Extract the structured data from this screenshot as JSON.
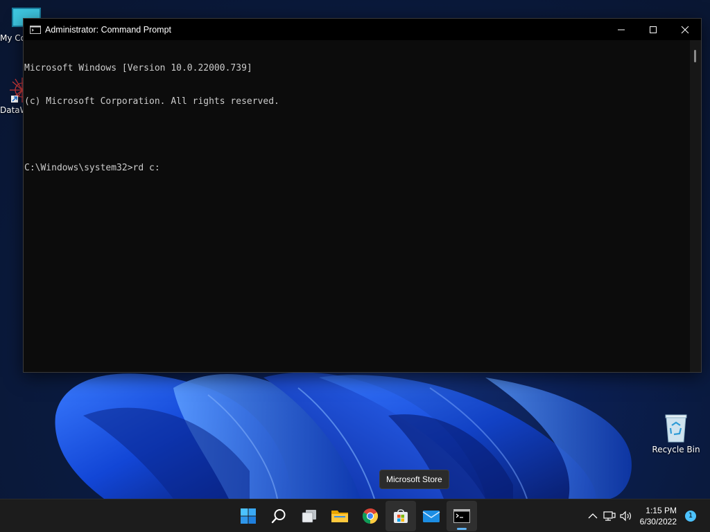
{
  "desktop": {
    "icons": [
      {
        "label": "My Computer",
        "icon": "monitor-icon"
      },
      {
        "label": "DataWarrior",
        "icon": "datawarrior-icon"
      },
      {
        "label": "Recycle Bin",
        "icon": "recycle-bin-icon"
      }
    ]
  },
  "window": {
    "title": "Administrator: Command Prompt",
    "controls": {
      "minimize": "minimize-icon",
      "maximize": "maximize-icon",
      "close": "close-icon"
    },
    "console_lines": [
      "Microsoft Windows [Version 10.0.22000.739]",
      "(c) Microsoft Corporation. All rights reserved.",
      "",
      "C:\\Windows\\system32>rd c:"
    ]
  },
  "tooltip": {
    "text": "Microsoft Store"
  },
  "taskbar": {
    "apps": [
      {
        "name": "Start",
        "icon": "windows-logo-icon"
      },
      {
        "name": "Search",
        "icon": "search-icon"
      },
      {
        "name": "Task View",
        "icon": "task-view-icon"
      },
      {
        "name": "File Explorer",
        "icon": "folder-icon"
      },
      {
        "name": "Google Chrome",
        "icon": "chrome-icon"
      },
      {
        "name": "Microsoft Store",
        "icon": "store-icon"
      },
      {
        "name": "Mail",
        "icon": "mail-icon"
      },
      {
        "name": "Command Prompt",
        "icon": "cmd-icon"
      }
    ],
    "tray": {
      "icons": [
        "chevron-up-icon",
        "network-icon",
        "volume-icon"
      ],
      "time": "1:15 PM",
      "date": "6/30/2022",
      "notification_count": "1"
    }
  },
  "colors": {
    "console_bg": "#0c0c0c",
    "console_text": "#cccccc",
    "taskbar_bg": "#1c1c1c",
    "accent": "#5fb2f2"
  }
}
